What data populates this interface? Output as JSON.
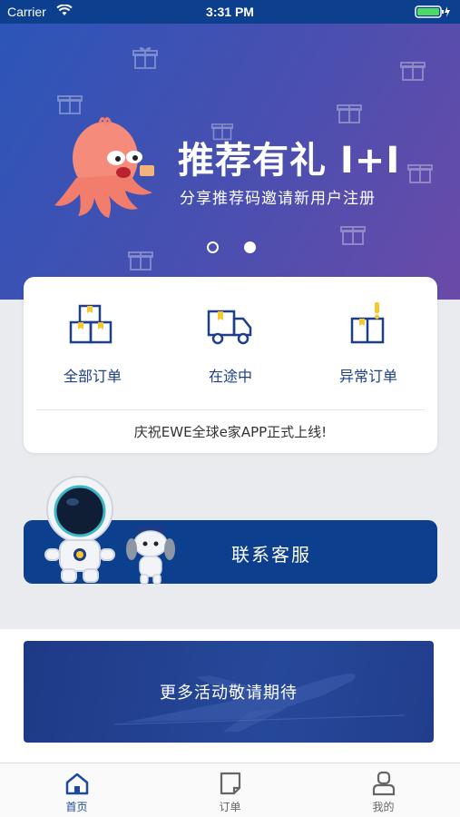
{
  "status_bar": {
    "carrier": "Carrier",
    "time": "3:31 PM"
  },
  "banner": {
    "title": "推荐有礼 I+I",
    "subtitle": "分享推荐码邀请新用户注册",
    "slide_count": 2,
    "active_slide": 2
  },
  "orders": {
    "items": [
      {
        "label": "全部订单",
        "icon": "boxes-icon"
      },
      {
        "label": "在途中",
        "icon": "truck-icon"
      },
      {
        "label": "异常订单",
        "icon": "alert-box-icon"
      }
    ],
    "notice": "庆祝EWE全球e家APP正式上线!"
  },
  "contact": {
    "label": "联系客服"
  },
  "activity": {
    "label": "更多活动敬请期待"
  },
  "tabs": [
    {
      "label": "首页",
      "icon": "home-icon",
      "active": true
    },
    {
      "label": "订单",
      "icon": "order-icon",
      "active": false
    },
    {
      "label": "我的",
      "icon": "profile-icon",
      "active": false
    }
  ],
  "colors": {
    "primary": "#0d3f8f",
    "accent": "#f7c82d",
    "background": "#e9ebee"
  }
}
